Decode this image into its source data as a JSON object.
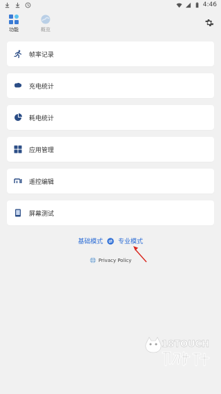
{
  "status_bar": {
    "time": "4:46",
    "left_icons": [
      "download-icon",
      "download-icon",
      "clock-icon"
    ],
    "right_icons": [
      "wifi-icon",
      "signal-icon",
      "battery-icon"
    ]
  },
  "nav": {
    "tabs": [
      {
        "label": "功能",
        "icon": "apps-icon",
        "active": true
      },
      {
        "label": "概览",
        "icon": "overview-icon",
        "active": false
      }
    ],
    "settings_icon": "gear-icon"
  },
  "menu": {
    "items": [
      {
        "label": "帧率记录",
        "icon": "running-icon"
      },
      {
        "label": "充电统计",
        "icon": "charging-icon"
      },
      {
        "label": "耗电统计",
        "icon": "pie-chart-icon"
      },
      {
        "label": "应用管理",
        "icon": "grid-icon"
      },
      {
        "label": "遥控编辑",
        "icon": "mi-icon"
      },
      {
        "label": "屏幕测试",
        "icon": "screen-icon"
      }
    ]
  },
  "mode_switch": {
    "basic_label": "基础模式",
    "pro_label": "专业模式",
    "icon": "swap-icon"
  },
  "privacy": {
    "label": "Privacy Policy",
    "icon": "globe-icon"
  },
  "watermark": {
    "brand": "18TOUCH",
    "icon": "cat-icon"
  },
  "colors": {
    "accent": "#2f6fd6",
    "background": "#f1f1f1",
    "card": "#ffffff",
    "arrow": "#d9251c"
  }
}
